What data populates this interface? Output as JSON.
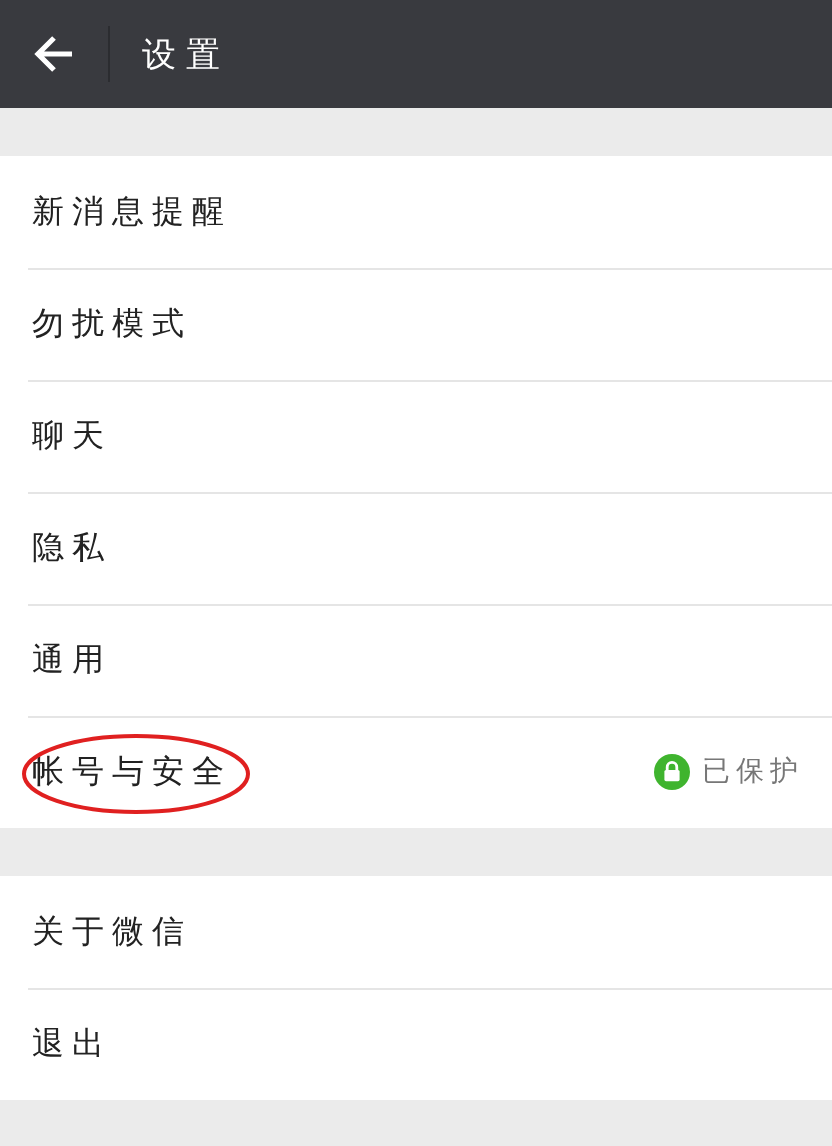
{
  "header": {
    "title": "设置"
  },
  "groups": [
    {
      "items": [
        {
          "label": "新消息提醒",
          "circled": false
        },
        {
          "label": "勿扰模式",
          "circled": false
        },
        {
          "label": "聊天",
          "circled": false
        },
        {
          "label": "隐私",
          "circled": false
        },
        {
          "label": "通用",
          "circled": false
        },
        {
          "label": "帐号与安全",
          "circled": true,
          "status": "已保护"
        }
      ]
    },
    {
      "items": [
        {
          "label": "关于微信",
          "circled": false
        },
        {
          "label": "退出",
          "circled": false
        }
      ]
    }
  ]
}
